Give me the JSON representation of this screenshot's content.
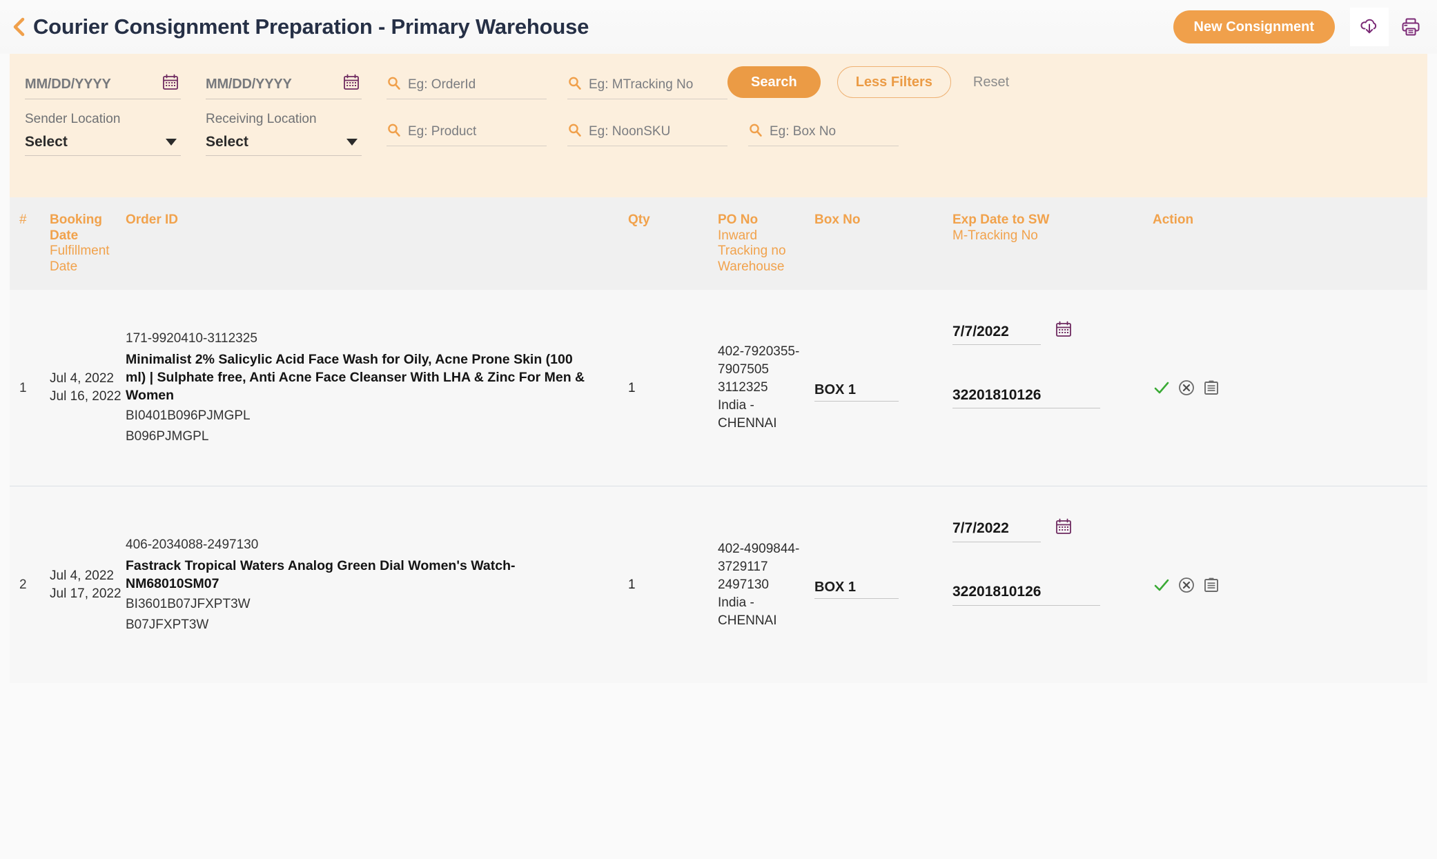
{
  "header": {
    "back_icon": "chevron-left-icon",
    "title": "Courier Consignment Preparation - Primary Warehouse",
    "new_consignment_label": "New Consignment",
    "download_icon": "cloud-download-icon",
    "print_icon": "print-icon"
  },
  "colors": {
    "accent_orange": "#f0a04b",
    "header_text": "#263046",
    "filter_bg": "#fcefdd",
    "table_header_bg": "#f0f0f0",
    "icon_purple": "#7b2a76",
    "check_green": "#3aaa35",
    "reset_gray": "#8c8c8c"
  },
  "filters": {
    "from_date": {
      "placeholder": "MM/DD/YYYY",
      "value": "",
      "calendar_icon": "calendar-icon"
    },
    "to_date": {
      "placeholder": "MM/DD/YYYY",
      "value": "",
      "calendar_icon": "calendar-icon"
    },
    "order_id": {
      "placeholder": "Eg: OrderId",
      "value": "",
      "icon": "search-icon"
    },
    "mtracking_no": {
      "placeholder": "Eg: MTracking No",
      "value": "",
      "icon": "search-icon"
    },
    "sender_location": {
      "label": "Sender Location",
      "value": "Select",
      "caret_icon": "chevron-down-icon"
    },
    "receiving_location": {
      "label": "Receiving Location",
      "value": "Select",
      "caret_icon": "chevron-down-icon"
    },
    "product": {
      "placeholder": "Eg: Product",
      "value": "",
      "icon": "search-icon"
    },
    "noon_sku": {
      "placeholder": "Eg: NoonSKU",
      "value": "",
      "icon": "search-icon"
    },
    "box_no": {
      "placeholder": "Eg: Box No",
      "value": "",
      "icon": "search-icon"
    },
    "search_label": "Search",
    "less_filters_label": "Less Filters",
    "reset_label": "Reset"
  },
  "table": {
    "headers": {
      "index": "#",
      "booking_date": "Booking",
      "booking_date2": "Date",
      "fulfillment_date": "Fulfillment",
      "fulfillment_date2": "Date",
      "order_id": "Order ID",
      "qty": "Qty",
      "po_no": "PO No",
      "inward": "Inward",
      "tracking_no": "Tracking no",
      "warehouse": "Warehouse",
      "box_no": "Box No",
      "exp_date_to_sw": "Exp Date to SW",
      "m_tracking_no": "M-Tracking No",
      "action": "Action"
    },
    "rows": [
      {
        "index": "1",
        "booking_date": "Jul 4, 2022",
        "fulfillment_date": "Jul 16, 2022",
        "order_id": "171-9920410-3112325",
        "product_title": "Minimalist 2% Salicylic Acid Face Wash for Oily, Acne Prone Skin (100 ml) | Sulphate free, Anti Acne Face Cleanser With LHA & Zinc For Men & Women",
        "sku1": "BI0401B096PJMGPL",
        "sku2": "B096PJMGPL",
        "qty": "1",
        "po_no_line1": "402-7920355-",
        "po_no_line2": "7907505",
        "inward_tracking": "3112325",
        "warehouse_line1": "India -",
        "warehouse_line2": "CHENNAI",
        "box_no": "BOX 1",
        "exp_date": "7/7/2022",
        "m_tracking_no": "32201810126",
        "calendar_icon": "calendar-icon",
        "approve_icon": "check-icon",
        "cancel_icon": "circle-x-icon",
        "notes_icon": "clipboard-icon"
      },
      {
        "index": "2",
        "booking_date": "Jul 4, 2022",
        "fulfillment_date": "Jul 17, 2022",
        "order_id": "406-2034088-2497130",
        "product_title": "Fastrack Tropical Waters Analog Green Dial Women's Watch-NM68010SM07",
        "sku1": "BI3601B07JFXPT3W",
        "sku2": "B07JFXPT3W",
        "qty": "1",
        "po_no_line1": "402-4909844-",
        "po_no_line2": "3729117",
        "inward_tracking": "2497130",
        "warehouse_line1": "India -",
        "warehouse_line2": "CHENNAI",
        "box_no": "BOX 1",
        "exp_date": "7/7/2022",
        "m_tracking_no": "32201810126",
        "calendar_icon": "calendar-icon",
        "approve_icon": "check-icon",
        "cancel_icon": "circle-x-icon",
        "notes_icon": "clipboard-icon"
      }
    ]
  }
}
